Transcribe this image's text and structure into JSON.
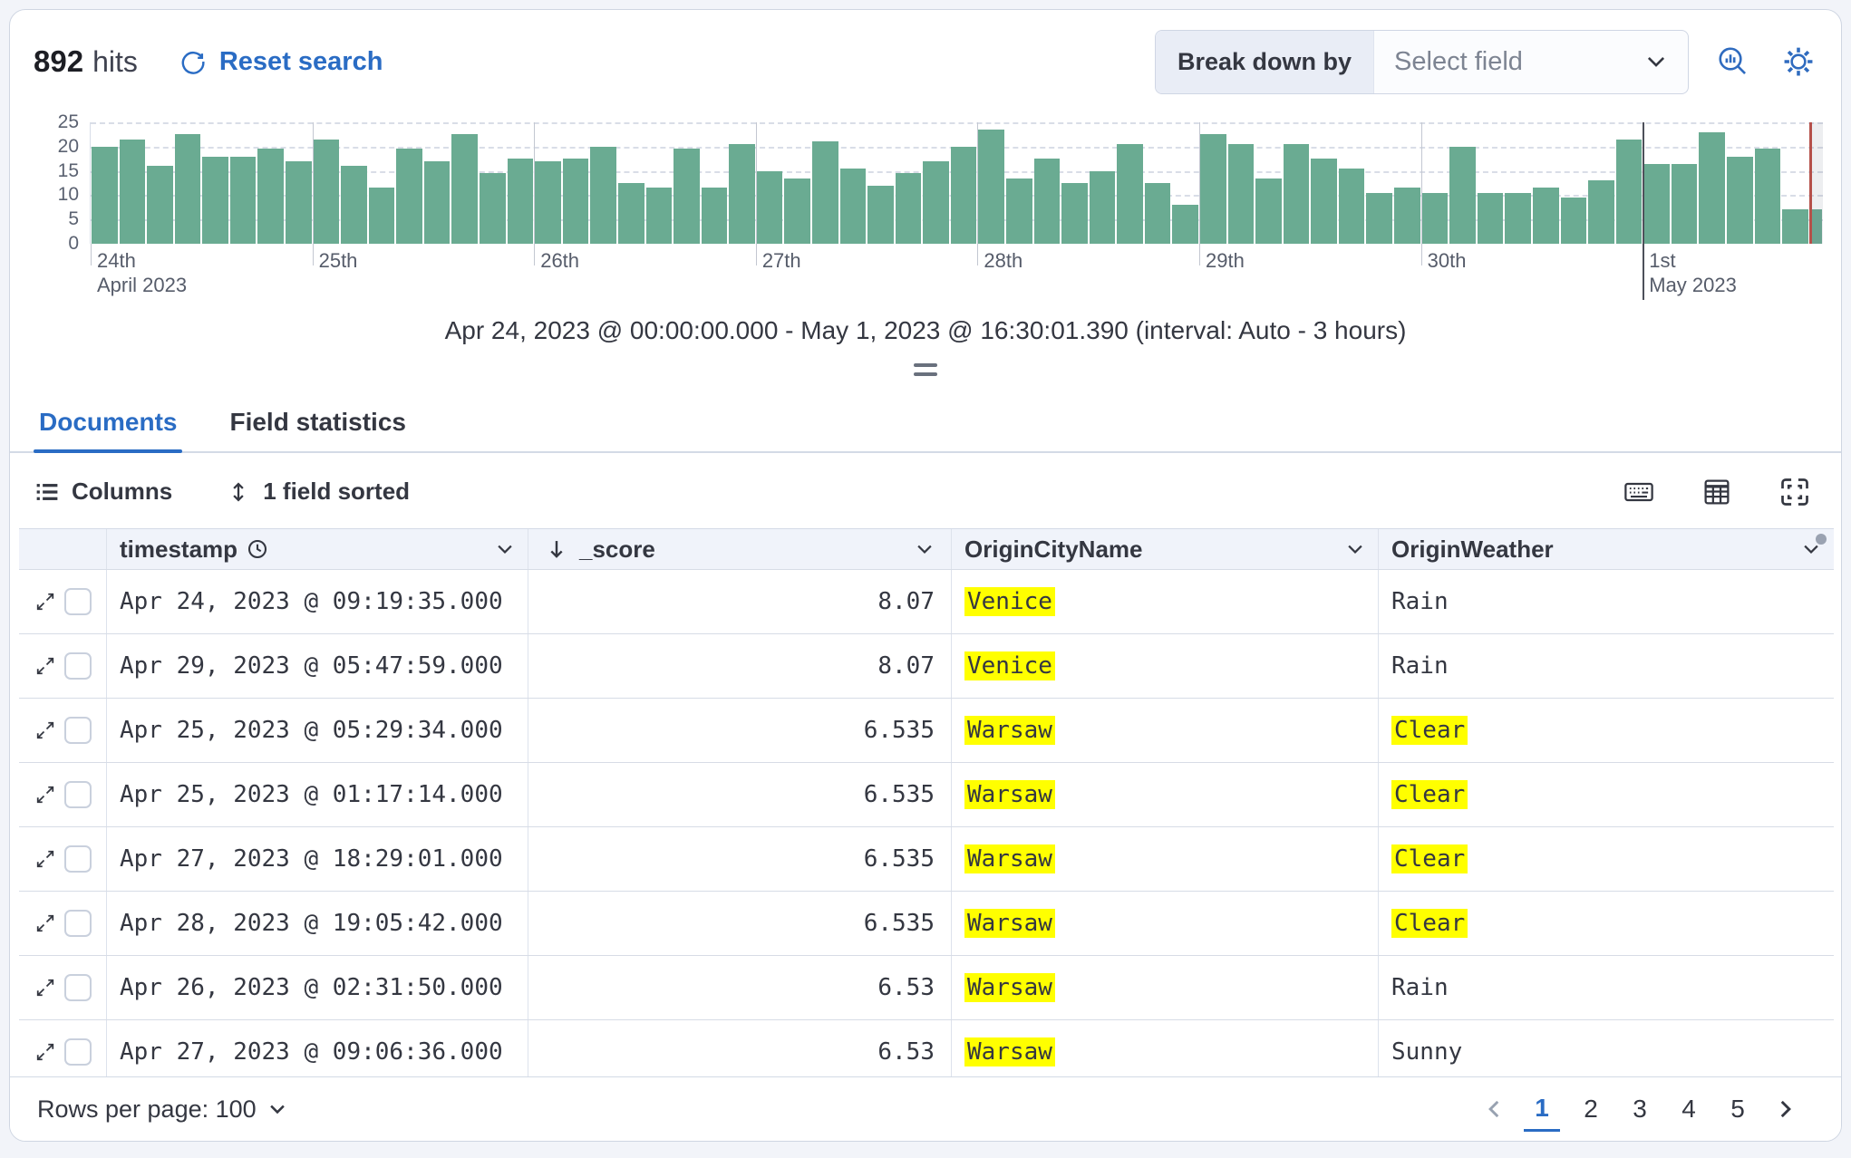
{
  "header": {
    "hits_count": "892",
    "hits_label": "hits",
    "reset_label": "Reset search",
    "breakdown_label": "Break down by",
    "breakdown_placeholder": "Select field",
    "accent_color": "#2a6cc4"
  },
  "chart_data": {
    "type": "bar",
    "title": "",
    "xlabel": "",
    "ylabel": "",
    "ylim": [
      0,
      25
    ],
    "yticks": [
      0,
      5,
      10,
      15,
      20,
      25
    ],
    "grid": "dashed-horizontal",
    "bar_color": "#6aab92",
    "current_time_marker_color": "#b5504a",
    "interval": "3 hours",
    "values": [
      20,
      21.5,
      16,
      22.5,
      18,
      18,
      19.5,
      17,
      21.5,
      16,
      11.5,
      19.5,
      17,
      22.5,
      14.5,
      17.5,
      17,
      17.5,
      20,
      12.5,
      11.5,
      19.5,
      11.5,
      20.5,
      15,
      13.5,
      21,
      15.5,
      12,
      14.5,
      17,
      20,
      23.5,
      13.5,
      17.5,
      12.5,
      15,
      20.5,
      12.5,
      8,
      22.5,
      20.5,
      13.5,
      20.5,
      17.5,
      15.5,
      10.5,
      11.5,
      10.5,
      20,
      10.5,
      10.5,
      11.5,
      9.5,
      13,
      21.5,
      16.5,
      16.5,
      23,
      18,
      19.5,
      7,
      7
    ],
    "last_bar_partial": true,
    "x_axis_labels": [
      {
        "slot": 0,
        "label": "24th",
        "sub": "April 2023"
      },
      {
        "slot": 8,
        "label": "25th",
        "sub": ""
      },
      {
        "slot": 16,
        "label": "26th",
        "sub": ""
      },
      {
        "slot": 24,
        "label": "27th",
        "sub": ""
      },
      {
        "slot": 32,
        "label": "28th",
        "sub": ""
      },
      {
        "slot": 40,
        "label": "29th",
        "sub": ""
      },
      {
        "slot": 48,
        "label": "30th",
        "sub": ""
      },
      {
        "slot": 56,
        "label": "1st",
        "sub": "May 2023",
        "dark": true
      }
    ],
    "day_separators_gray": [
      8,
      16,
      24,
      32,
      40,
      48
    ],
    "day_separators_dark": [
      56
    ],
    "caption": "Apr 24, 2023 @ 00:00:00.000 - May 1, 2023 @ 16:30:01.390 (interval: Auto - 3 hours)"
  },
  "tabs": [
    {
      "label": "Documents",
      "active": true
    },
    {
      "label": "Field statistics",
      "active": false
    }
  ],
  "toolbar": {
    "columns_label": "Columns",
    "sorted_label": "1 field sorted"
  },
  "grid": {
    "columns": [
      {
        "label": "timestamp",
        "icon": "clock"
      },
      {
        "label": "_score",
        "sorted": "desc"
      },
      {
        "label": "OriginCityName"
      },
      {
        "label": "OriginWeather"
      }
    ],
    "highlight_color": "#ffff00",
    "rows": [
      {
        "timestamp": "Apr 24, 2023 @ 09:19:35.000",
        "score": "8.07",
        "city": "Venice",
        "city_highlight": true,
        "weather": "Rain",
        "weather_highlight": false
      },
      {
        "timestamp": "Apr 29, 2023 @ 05:47:59.000",
        "score": "8.07",
        "city": "Venice",
        "city_highlight": true,
        "weather": "Rain",
        "weather_highlight": false
      },
      {
        "timestamp": "Apr 25, 2023 @ 05:29:34.000",
        "score": "6.535",
        "city": "Warsaw",
        "city_highlight": true,
        "weather": "Clear",
        "weather_highlight": true
      },
      {
        "timestamp": "Apr 25, 2023 @ 01:17:14.000",
        "score": "6.535",
        "city": "Warsaw",
        "city_highlight": true,
        "weather": "Clear",
        "weather_highlight": true
      },
      {
        "timestamp": "Apr 27, 2023 @ 18:29:01.000",
        "score": "6.535",
        "city": "Warsaw",
        "city_highlight": true,
        "weather": "Clear",
        "weather_highlight": true
      },
      {
        "timestamp": "Apr 28, 2023 @ 19:05:42.000",
        "score": "6.535",
        "city": "Warsaw",
        "city_highlight": true,
        "weather": "Clear",
        "weather_highlight": true
      },
      {
        "timestamp": "Apr 26, 2023 @ 02:31:50.000",
        "score": "6.53",
        "city": "Warsaw",
        "city_highlight": true,
        "weather": "Rain",
        "weather_highlight": false
      },
      {
        "timestamp": "Apr 27, 2023 @ 09:06:36.000",
        "score": "6.53",
        "city": "Warsaw",
        "city_highlight": true,
        "weather": "Sunny",
        "weather_highlight": false
      }
    ]
  },
  "footer": {
    "rows_per_page_label": "Rows per page: 100",
    "pages": [
      "1",
      "2",
      "3",
      "4",
      "5"
    ],
    "active_page": "1"
  }
}
